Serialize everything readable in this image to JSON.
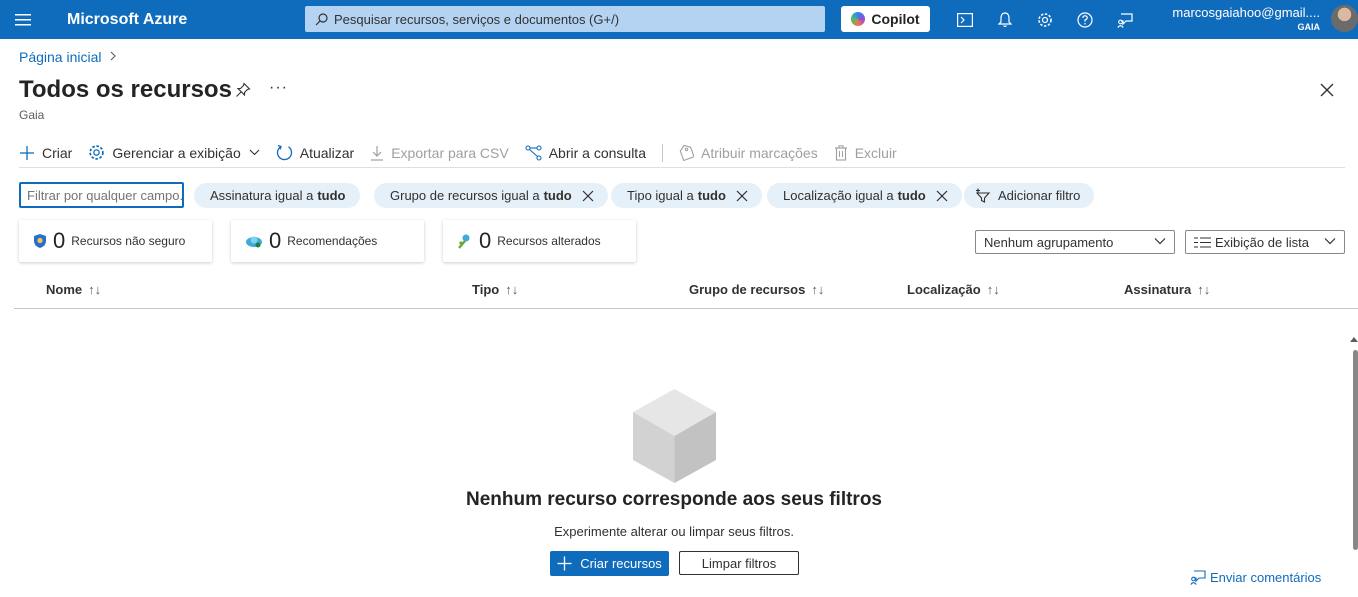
{
  "topbar": {
    "brand": "Microsoft Azure",
    "search_placeholder": "Pesquisar recursos, serviços e documentos (G+/)",
    "copilot_label": "Copilot",
    "user_email": "marcosgaiahoo@gmail....",
    "user_tenant": "GAIA"
  },
  "breadcrumb": {
    "home": "Página inicial"
  },
  "page": {
    "title": "Todos os recursos",
    "subtitle": "Gaia"
  },
  "toolbar": {
    "create": "Criar",
    "manage_view": "Gerenciar a exibição",
    "refresh": "Atualizar",
    "export_csv": "Exportar para CSV",
    "open_query": "Abrir a consulta",
    "assign_tags": "Atribuir marcações",
    "delete": "Excluir"
  },
  "filters": {
    "input_placeholder": "Filtrar por qualquer campo...",
    "pills": [
      {
        "label": "Assinatura igual a",
        "value": "tudo"
      },
      {
        "label": "Grupo de recursos igual a",
        "value": "tudo"
      },
      {
        "label": "Tipo igual a",
        "value": "tudo"
      },
      {
        "label": "Localização igual a",
        "value": "tudo"
      }
    ],
    "add_filter": "Adicionar filtro"
  },
  "cards": [
    {
      "count": "0",
      "label": "Recursos não seguro"
    },
    {
      "count": "0",
      "label": "Recomendações"
    },
    {
      "count": "0",
      "label": "Recursos alterados"
    }
  ],
  "grouping": {
    "selected": "Nenhum agrupamento"
  },
  "view_mode": {
    "selected": "Exibição de lista"
  },
  "table": {
    "columns": [
      "Nome",
      "Tipo",
      "Grupo de recursos",
      "Localização",
      "Assinatura"
    ]
  },
  "empty_state": {
    "title": "Nenhum recurso corresponde aos seus filtros",
    "subtitle": "Experimente alterar ou limpar seus filtros.",
    "create_button": "Criar recursos",
    "clear_button": "Limpar filtros"
  },
  "feedback": "Enviar comentários",
  "colors": {
    "accent": "#0f6cbd",
    "pill_bg": "#e6f0f8"
  }
}
